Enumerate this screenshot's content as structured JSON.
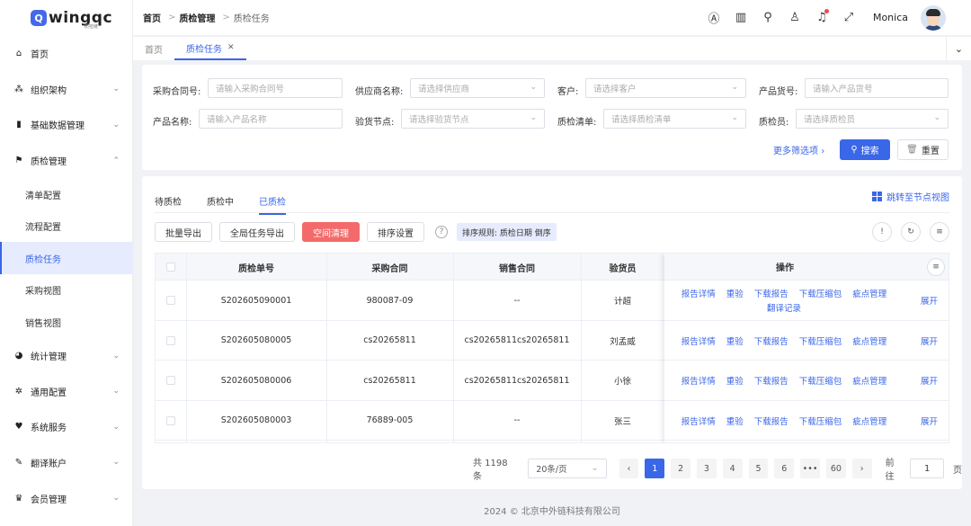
{
  "app": {
    "logo_text": "wingqc",
    "logo_sub": "质检链"
  },
  "sidebar": {
    "items": [
      {
        "label": "首页",
        "icon": "home-icon"
      },
      {
        "label": "组织架构",
        "icon": "org-icon"
      },
      {
        "label": "基础数据管理",
        "icon": "chart-icon"
      },
      {
        "label": "质检管理",
        "icon": "inspect-icon"
      },
      {
        "label": "统计管理",
        "icon": "pie-icon"
      },
      {
        "label": "通用配置",
        "icon": "gear-icon"
      },
      {
        "label": "系统服务",
        "icon": "service-icon"
      },
      {
        "label": "翻译账户",
        "icon": "translate-icon"
      },
      {
        "label": "会员管理",
        "icon": "crown-icon"
      }
    ],
    "subitems": [
      {
        "label": "清单配置"
      },
      {
        "label": "流程配置"
      },
      {
        "label": "质检任务"
      },
      {
        "label": "采购视图"
      },
      {
        "label": "销售视图"
      }
    ]
  },
  "header": {
    "breadcrumb": [
      "首页",
      "质检管理",
      "质检任务"
    ],
    "username": "Monica"
  },
  "tabs": [
    {
      "label": "首页"
    },
    {
      "label": "质检任务"
    }
  ],
  "filters": {
    "contract_no": {
      "label": "采购合同号:",
      "placeholder": "请输入采购合同号"
    },
    "supplier": {
      "label": "供应商名称:",
      "placeholder": "请选择供应商"
    },
    "customer": {
      "label": "客户:",
      "placeholder": "请选择客户"
    },
    "product_code": {
      "label": "产品货号:",
      "placeholder": "请输入产品货号"
    },
    "product_name": {
      "label": "产品名称:",
      "placeholder": "请输入产品名称"
    },
    "node": {
      "label": "验货节点:",
      "placeholder": "请选择验货节点"
    },
    "checklist": {
      "label": "质检清单:",
      "placeholder": "请选择质检清单"
    },
    "inspector": {
      "label": "质检员:",
      "placeholder": "请选择质检员"
    },
    "more": "更多筛选项",
    "search": "搜索",
    "reset": "重置"
  },
  "status_tabs": [
    {
      "label": "待质检"
    },
    {
      "label": "质检中"
    },
    {
      "label": "已质检"
    }
  ],
  "jump_link": "跳转至节点视图",
  "toolbar": {
    "batch_export": "批量导出",
    "export_all": "全局任务导出",
    "clear_space": "空间清理",
    "sort_setting": "排序设置",
    "sort_rule": "排序规则: 质检日期 倒序"
  },
  "table": {
    "headers": {
      "inspect_no": "质检单号",
      "purchase": "采购合同",
      "sales": "销售合同",
      "inspector": "验货员",
      "ops": "操作"
    },
    "rows": [
      {
        "inspect_no": "S202605090001",
        "purchase": "980087-09",
        "sales": "--",
        "inspector": "计超"
      },
      {
        "inspect_no": "S202605080005",
        "purchase": "cs20265811",
        "sales": "cs20265811cs20265811",
        "inspector": "刘孟威"
      },
      {
        "inspect_no": "S202605080006",
        "purchase": "cs20265811",
        "sales": "cs20265811cs20265811",
        "inspector": "小徐"
      },
      {
        "inspect_no": "S202605080003",
        "purchase": "76889-005",
        "sales": "--",
        "inspector": "张三"
      }
    ],
    "ops": {
      "report_detail": "报告详情",
      "recheck": "重验",
      "download_report": "下载报告",
      "download_zip": "下载压缩包",
      "defect_mgmt": "疵点管理",
      "translate_log": "翻译记录",
      "expand": "展开"
    }
  },
  "pagination": {
    "total": "共 1198 条",
    "page_size": "20条/页",
    "pages": [
      "1",
      "2",
      "3",
      "4",
      "5",
      "6",
      "•••",
      "60"
    ],
    "goto": "前往",
    "goto_value": "1",
    "unit": "页"
  },
  "footer": "2024 © 北京中外链科技有限公司"
}
